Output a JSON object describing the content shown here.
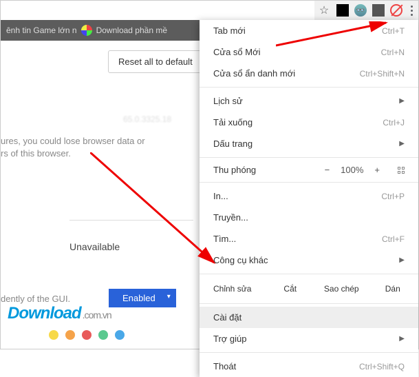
{
  "toolbar": {
    "icons": [
      "star-icon",
      "extension-1",
      "extension-2",
      "extension-3",
      "blocker-icon",
      "menu-icon"
    ]
  },
  "bookmarks": {
    "item1": "ênh tin Game lớn n",
    "item2": "Download phần mề"
  },
  "page": {
    "reset_button": "Reset all to default",
    "blurred_version": "65.0.3325.18",
    "warning_line1": "ures, you could lose browser data or",
    "warning_line2": "rs of this browser.",
    "unavailable": "Unavailable",
    "gui_text": "dently of the GUI.",
    "enabled_label": "Enabled"
  },
  "logo": {
    "text": "Download",
    "suffix": ".com.vn",
    "dot_colors": [
      "#f7d948",
      "#f5a34a",
      "#e85a5a",
      "#5ac98f",
      "#4aa8e8"
    ]
  },
  "menu": {
    "new_tab": {
      "label": "Tab mới",
      "shortcut": "Ctrl+T"
    },
    "new_window": {
      "label": "Cửa sổ Mới",
      "shortcut": "Ctrl+N"
    },
    "incognito": {
      "label": "Cửa sổ ẩn danh mới",
      "shortcut": "Ctrl+Shift+N"
    },
    "history": {
      "label": "Lịch sử"
    },
    "downloads": {
      "label": "Tải xuống",
      "shortcut": "Ctrl+J"
    },
    "bookmarks": {
      "label": "Dấu trang"
    },
    "zoom": {
      "label": "Thu phóng",
      "minus": "−",
      "value": "100%",
      "plus": "+"
    },
    "print": {
      "label": "In...",
      "shortcut": "Ctrl+P"
    },
    "cast": {
      "label": "Truyền..."
    },
    "find": {
      "label": "Tìm...",
      "shortcut": "Ctrl+F"
    },
    "more_tools": {
      "label": "Công cụ khác"
    },
    "edit": {
      "label": "Chỉnh sửa",
      "cut": "Cắt",
      "copy": "Sao chép",
      "paste": "Dán"
    },
    "settings": {
      "label": "Cài đặt"
    },
    "help": {
      "label": "Trợ giúp"
    },
    "exit": {
      "label": "Thoát",
      "shortcut": "Ctrl+Shift+Q"
    }
  }
}
